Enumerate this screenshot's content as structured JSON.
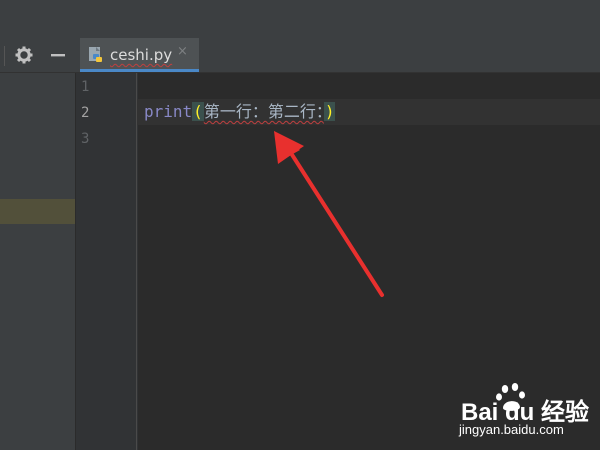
{
  "editor": {
    "tab": {
      "filename": "ceshi.py",
      "close_glyph": "×",
      "icon": "python-file-icon"
    },
    "toolbar": {
      "settings_icon": "gear-icon",
      "hide_icon": "minimize-icon"
    },
    "gutter": {
      "line_numbers": [
        "1",
        "2",
        "3"
      ],
      "active_line": "2"
    },
    "code": {
      "line2": {
        "keyword": "print",
        "open_paren": "(",
        "string": "第一行：第二行：",
        "close_paren": ")"
      }
    },
    "colors": {
      "background": "#2b2b2b",
      "keyword": "#8888c6",
      "paren_highlight": "#ffef28",
      "annotation_arrow": "#e8302e",
      "tab_underline": "#4a88c7"
    }
  },
  "watermark": {
    "brand": "Bai du 经验",
    "url": "jingyan.baidu.com"
  }
}
